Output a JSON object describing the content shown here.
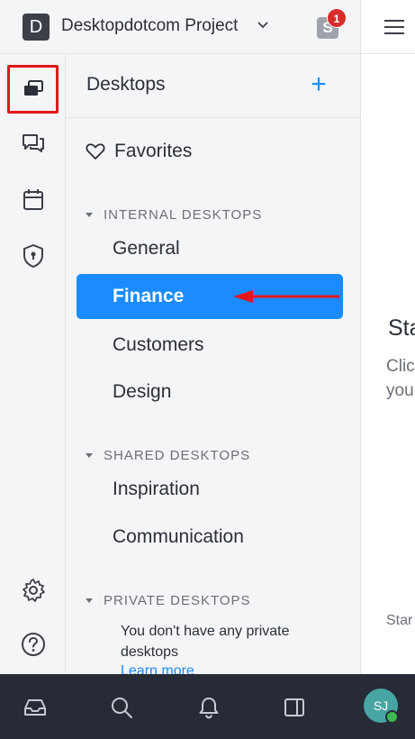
{
  "header": {
    "logo_letter": "D",
    "project_name": "Desktopdotcom Project",
    "user_badge_letter": "S",
    "notification_count": "1"
  },
  "sidebar": {
    "title": "Desktops",
    "add_label": "+",
    "favorites_label": "Favorites",
    "sections": [
      {
        "label": "INTERNAL DESKTOPS",
        "items": [
          "General",
          "Finance",
          "Customers",
          "Design"
        ]
      },
      {
        "label": "SHARED DESKTOPS",
        "items": [
          "Inspiration",
          "Communication"
        ]
      },
      {
        "label": "PRIVATE DESKTOPS",
        "items": []
      }
    ],
    "selected_item": "Finance",
    "private_empty_text": "You don't have any private desktops",
    "learn_more": "Learn more"
  },
  "content": {
    "title_partial": "Sta",
    "subtitle_partial_line1": "Clic",
    "subtitle_partial_line2": "you",
    "footer_partial": "Star"
  },
  "bottombar": {
    "avatar_initials": "SJ"
  },
  "colors": {
    "accent": "#1a8cff",
    "annotation_red": "#e4161b",
    "notification_red": "#d92c2c",
    "bottom_bar": "#262b36",
    "avatar": "#47a5a3",
    "presence_online": "#3dba4e"
  },
  "icons": {
    "rail": [
      "desktops-icon",
      "chat-icon",
      "calendar-icon",
      "shield-icon",
      "settings-icon",
      "help-icon"
    ],
    "bottom": [
      "inbox-icon",
      "search-icon",
      "bell-icon",
      "panel-icon"
    ]
  }
}
